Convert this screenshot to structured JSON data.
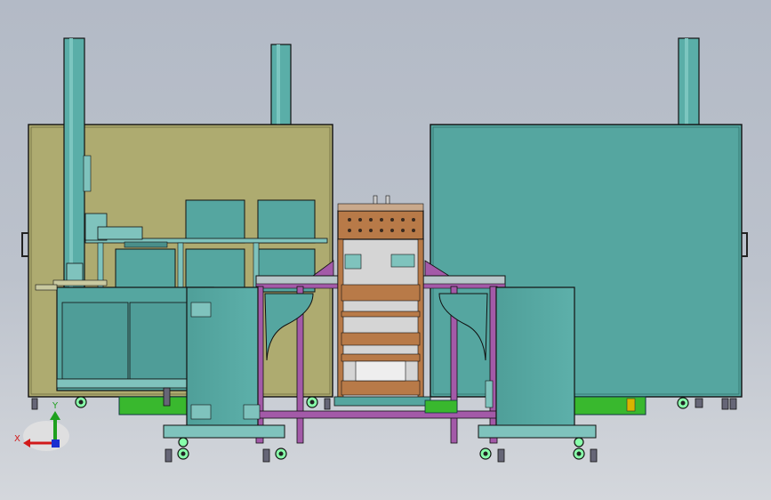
{
  "axis_triad": {
    "x_label": "X",
    "y_label": "Y"
  },
  "colors": {
    "background_top": "#b3bac6",
    "background_bottom": "#d4d7dc",
    "left_enclosure": "#aeab70",
    "teal_panel": "#55a6a0",
    "teal_light": "#63b5ae",
    "frame_purple": "#a35aa8",
    "control_cabinet": "#b87a48",
    "base_green": "#39b82e",
    "x_axis": "#d11a1a",
    "y_axis": "#1ea01e",
    "z_axis": "#1b2fd0"
  }
}
